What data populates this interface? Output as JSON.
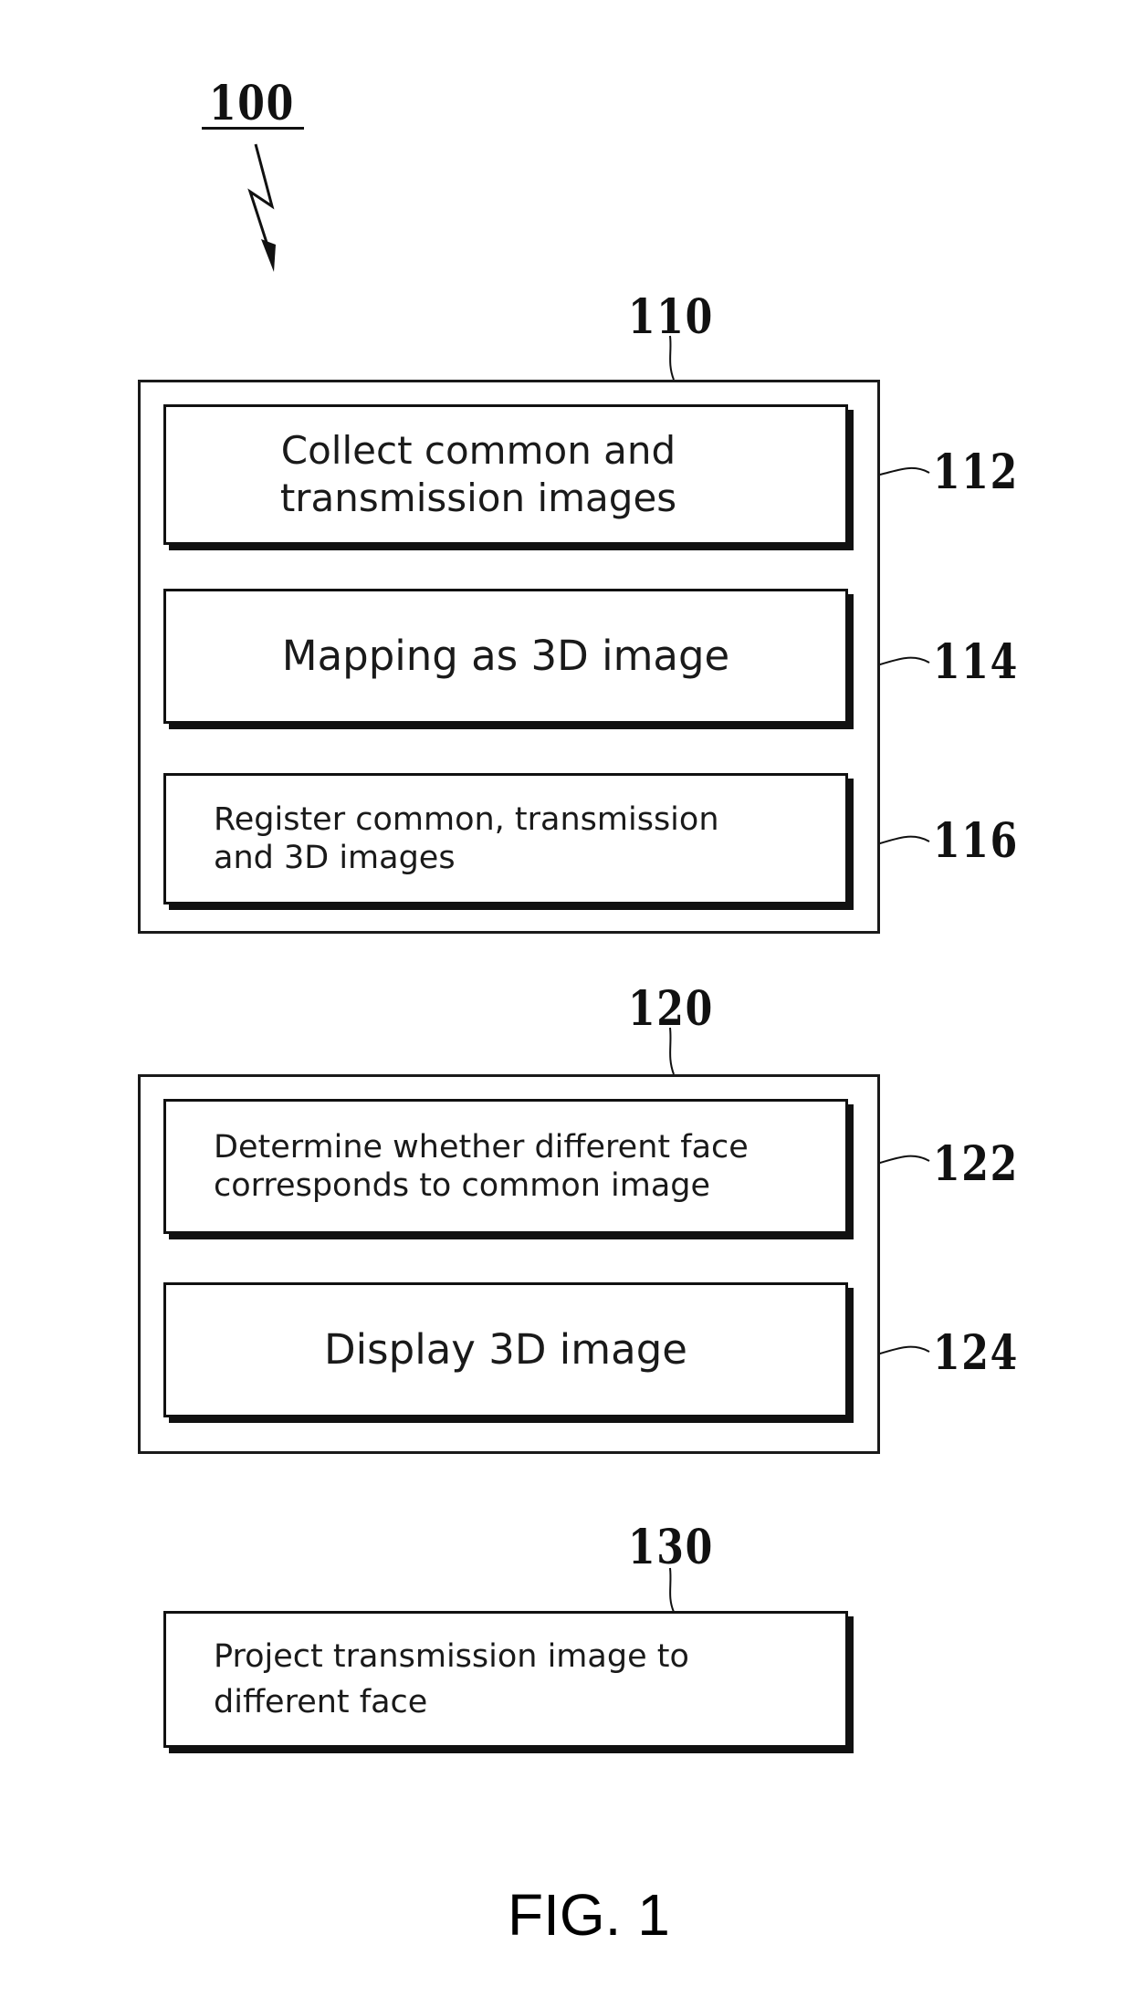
{
  "figure": {
    "caption": "FIG. 1",
    "system_ref": "100"
  },
  "groups": [
    {
      "ref": "110",
      "steps": [
        {
          "ref": "112",
          "label": "Collect common and\ntransmission images"
        },
        {
          "ref": "114",
          "label": "Mapping as 3D image"
        },
        {
          "ref": "116",
          "label": "Register common, transmission\nand 3D images"
        }
      ]
    },
    {
      "ref": "120",
      "steps": [
        {
          "ref": "122",
          "label": "Determine whether different face\ncorresponds to common image"
        },
        {
          "ref": "124",
          "label": "Display 3D image"
        }
      ]
    }
  ],
  "standalone_step": {
    "ref": "130",
    "label": "Project transmission image to\ndifferent face"
  },
  "colors": {
    "line": "#111111",
    "background": "#ffffff"
  }
}
